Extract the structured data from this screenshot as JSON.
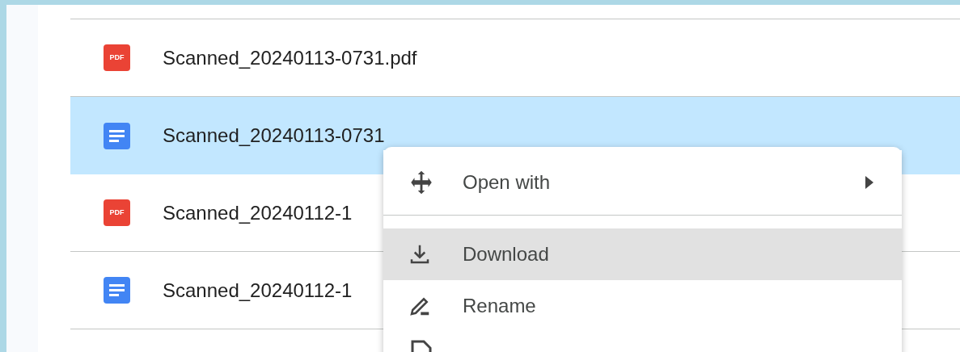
{
  "files": [
    {
      "name": "Scanned_20240113-0731.pdf",
      "kind": "pdf",
      "badge": "PDF",
      "selected": false
    },
    {
      "name": "Scanned_20240113-0731",
      "kind": "doc",
      "selected": true
    },
    {
      "name": "Scanned_20240112-1",
      "kind": "pdf",
      "badge": "PDF",
      "selected": false
    },
    {
      "name": "Scanned_20240112-1",
      "kind": "doc",
      "selected": false
    }
  ],
  "context_menu": {
    "items": [
      {
        "label": "Open with",
        "kind": "submenu",
        "highlighted": false
      },
      {
        "label": "Download",
        "kind": "action",
        "highlighted": true
      },
      {
        "label": "Rename",
        "kind": "action",
        "highlighted": false
      }
    ]
  }
}
